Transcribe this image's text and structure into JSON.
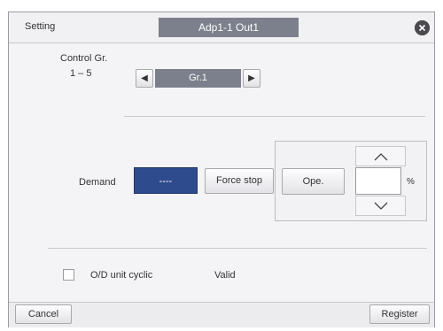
{
  "titlebar": {
    "label": "Setting",
    "tab": "Adp1-1 Out1",
    "close_icon": "close-icon"
  },
  "control_group": {
    "label_line1": "Control Gr.",
    "label_line2": "1 – 5",
    "prev_icon": "◀",
    "value": "Gr.1",
    "next_icon": "▶"
  },
  "demand": {
    "label": "Demand",
    "value": "----",
    "force_stop_label": "Force stop",
    "ope_label": "Ope.",
    "up_icon": "chevron-up-icon",
    "down_icon": "chevron-down-icon",
    "percent_value": "",
    "unit": "%"
  },
  "cyclic": {
    "label": "O/D unit cyclic",
    "status": "Valid",
    "checked": false
  },
  "footer": {
    "cancel_label": "Cancel",
    "register_label": "Register"
  }
}
